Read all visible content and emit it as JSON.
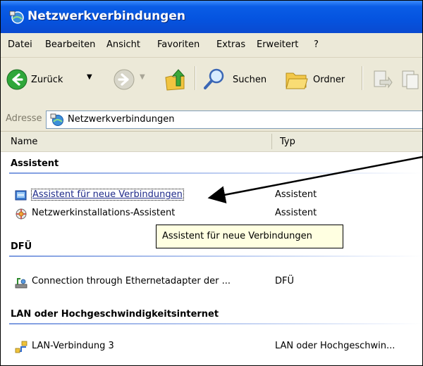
{
  "window": {
    "title": "Netzwerkverbindungen"
  },
  "menu": [
    "Datei",
    "Bearbeiten",
    "Ansicht",
    "Favoriten",
    "Extras",
    "Erweitert",
    "?"
  ],
  "toolbar": {
    "back_label": "Zurück",
    "search_label": "Suchen",
    "folders_label": "Ordner"
  },
  "address": {
    "label": "Adresse",
    "value": "Netzwerkverbindungen"
  },
  "columns": {
    "name": "Name",
    "type": "Typ"
  },
  "groups": [
    {
      "title": "Assistent",
      "items": [
        {
          "name": "Assistent für neue Verbindungen",
          "type": "Assistent",
          "selected": true
        },
        {
          "name": "Netzwerkinstallations-Assistent",
          "type": "Assistent"
        }
      ]
    },
    {
      "title": "DFÜ",
      "items": [
        {
          "name": "Connection through Ethernetadapter der ...",
          "type": "DFÜ"
        }
      ]
    },
    {
      "title": "LAN oder Hochgeschwindigkeitsinternet",
      "items": [
        {
          "name": "LAN-Verbindung 3",
          "type": "LAN oder Hochgeschwin..."
        }
      ]
    }
  ],
  "tooltip": {
    "text": "Assistent für neue Verbindungen"
  },
  "colors": {
    "title_bar": "#0554e0",
    "chrome": "#ece9d8",
    "selection": "#1e2a8a",
    "tooltip_bg": "#ffffe1"
  }
}
